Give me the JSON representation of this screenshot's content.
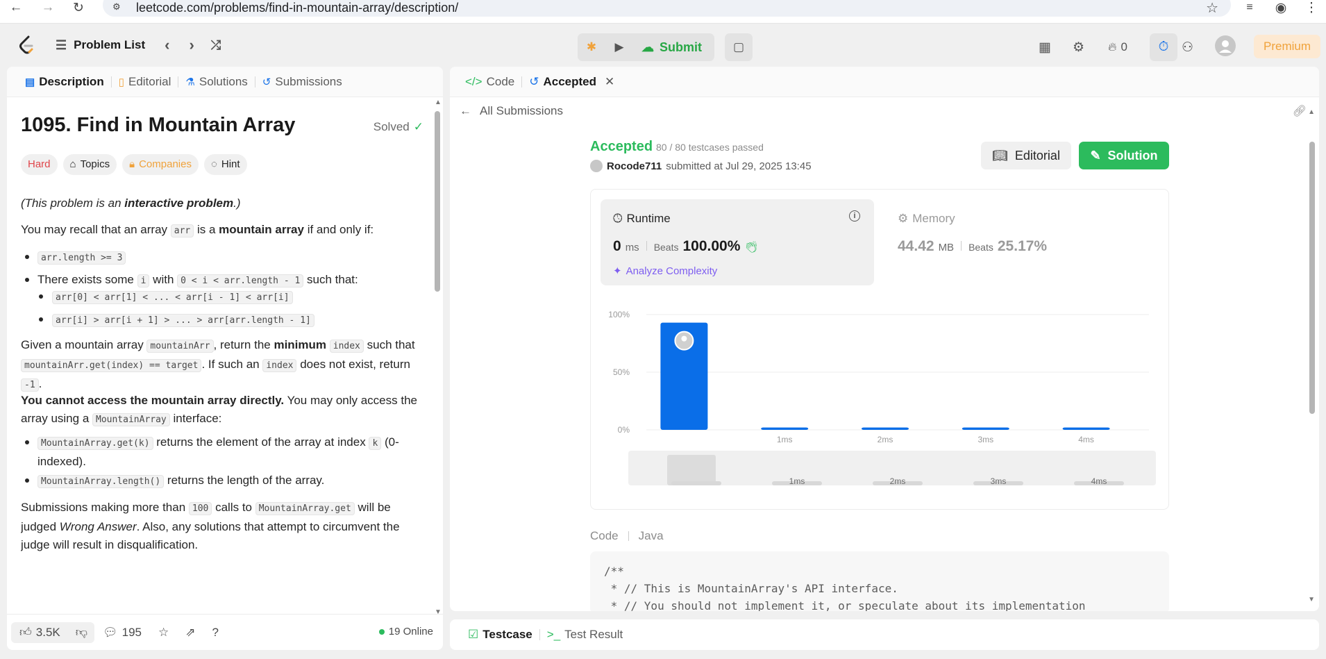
{
  "browser": {
    "url": "leetcode.com/problems/find-in-mountain-array/description/"
  },
  "topnav": {
    "problem_list_label": "Problem List",
    "submit_label": "Submit",
    "streak_count": "0",
    "premium_label": "Premium"
  },
  "left_tabs": [
    {
      "label": "Description",
      "icon": "description-icon"
    },
    {
      "label": "Editorial",
      "icon": "book-icon"
    },
    {
      "label": "Solutions",
      "icon": "flask-icon"
    },
    {
      "label": "Submissions",
      "icon": "history-icon"
    }
  ],
  "problem": {
    "title": "1095. Find in Mountain Array",
    "solved_label": "Solved",
    "tags": [
      "Hard",
      "Topics",
      "Companies",
      "Hint"
    ],
    "intro_prefix": "(This problem is an ",
    "intro_bold": "interactive problem",
    "intro_suffix": ".)",
    "recall_pre": "You may recall that an array ",
    "recall_code": "arr",
    "recall_mid": " is a ",
    "recall_bold": "mountain array",
    "recall_post": " if and only if:",
    "bullet1_code": "arr.length >= 3",
    "bullet2_pre": "There exists some ",
    "bullet2_code1": "i",
    "bullet2_mid": " with ",
    "bullet2_code2": "0 < i < arr.length - 1",
    "bullet2_post": " such that:",
    "sub1_code": "arr[0] < arr[1] < ... < arr[i - 1] < arr[i]",
    "sub2_code": "arr[i] > arr[i + 1] > ... > arr[arr.length - 1]",
    "given_pre": "Given a mountain array ",
    "given_code1": "mountainArr",
    "given_mid1": ", return the ",
    "given_bold": "minimum",
    "given_code2": "index",
    "given_mid2": " such that ",
    "given_code3": "mountainArr.get(index) == target",
    "given_mid3": ". If such an ",
    "given_code4": "index",
    "given_mid4": " does not exist, return ",
    "given_code5": "-1",
    "given_post": ".",
    "cannot_bold": "You cannot access the mountain array directly.",
    "cannot_rest": " You may only access the array using a ",
    "cannot_code": "MountainArray",
    "cannot_post": " interface:",
    "api1_code": "MountainArray.get(k)",
    "api1_text": " returns the element of the array at index ",
    "api1_code2": "k",
    "api1_post": " (0-indexed).",
    "api2_code": "MountainArray.length()",
    "api2_text": " returns the length of the array.",
    "subm_pre": "Submissions making more than ",
    "subm_code1": "100",
    "subm_mid": " calls to ",
    "subm_code2": "MountainArray.get",
    "subm_mid2": " will be judged ",
    "subm_italic": "Wrong Answer",
    "subm_post": ". Also, any solutions that attempt to circumvent the judge will result in disqualification."
  },
  "footer": {
    "likes": "3.5K",
    "comments": "195",
    "online": "19 Online"
  },
  "right_tabs": [
    {
      "label": "Code",
      "icon": "code-icon"
    },
    {
      "label": "Accepted",
      "icon": "history-icon"
    }
  ],
  "submission": {
    "back_label": "All Submissions",
    "status": "Accepted",
    "testcases": "80 / 80 testcases passed",
    "user": "Rocode711",
    "submitted_text": "submitted at Jul 29, 2025 13:45",
    "editorial_label": "Editorial",
    "solution_label": "Solution",
    "runtime_label": "Runtime",
    "runtime_value": "0",
    "runtime_unit": "ms",
    "beats_label": "Beats",
    "runtime_beats": "100.00%",
    "analyze_label": "Analyze Complexity",
    "memory_label": "Memory",
    "memory_value": "44.42",
    "memory_unit": "MB",
    "memory_beats": "25.17%",
    "code_label": "Code",
    "language": "Java",
    "code_lines": "/**\n * // This is MountainArray's API interface.\n * // You should not implement it, or speculate about its implementation"
  },
  "bottom_tabs": [
    {
      "label": "Testcase"
    },
    {
      "label": "Test Result"
    }
  ],
  "colors": {
    "accent_green": "#2cbb5d",
    "bar_blue": "#0a6ee8",
    "premium_orange": "#f0a23b",
    "hard_red": "#e0454a"
  },
  "chart_data": {
    "type": "bar",
    "categories": [
      "",
      "1ms",
      "2ms",
      "3ms",
      "4ms"
    ],
    "values": [
      93,
      2,
      2,
      2,
      2
    ],
    "y_ticks": [
      "100%",
      "50%",
      "0%"
    ],
    "ylim": [
      0,
      100
    ],
    "highlight_index": 0,
    "grid": true
  }
}
